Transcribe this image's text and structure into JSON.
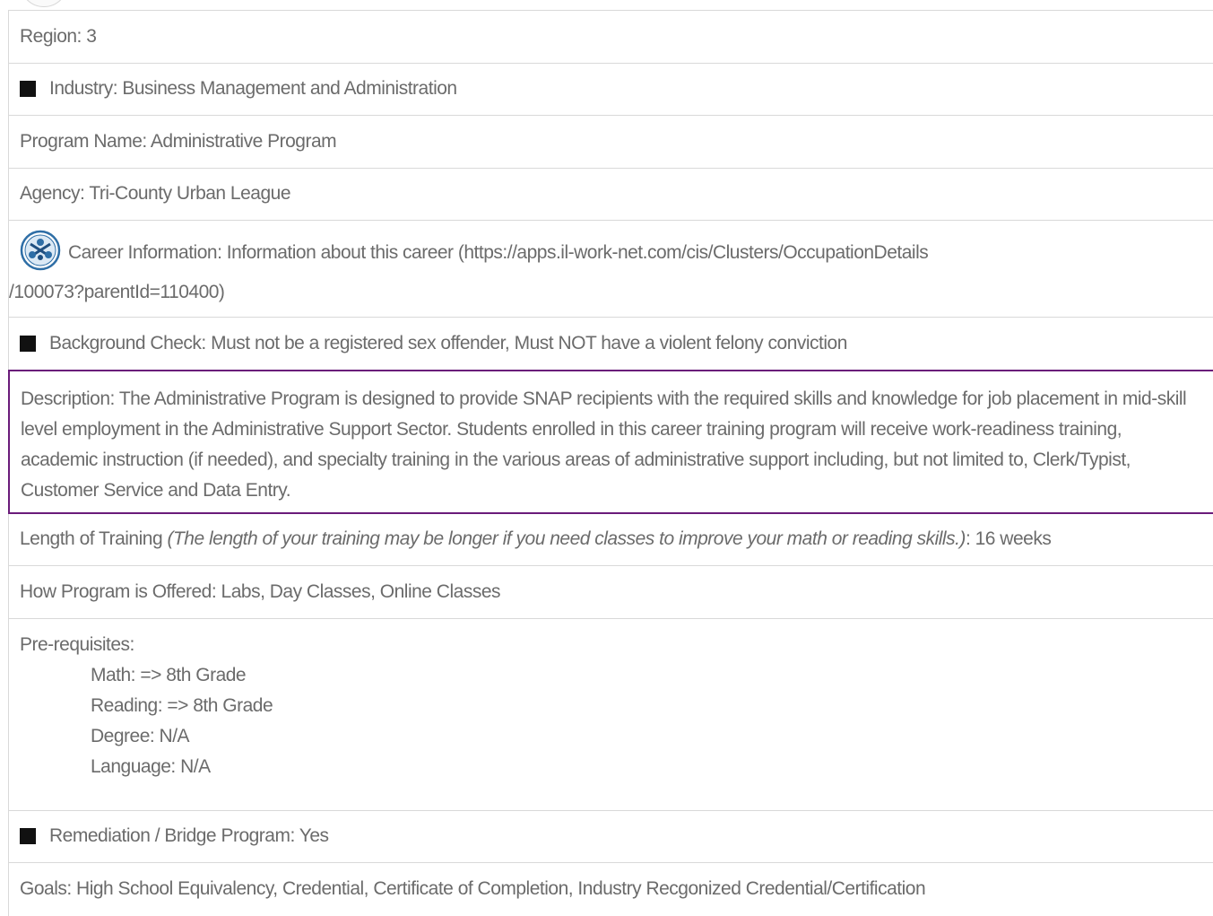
{
  "rows": {
    "region": "Region: 3",
    "industry": "Industry: Business Management and Administration",
    "program_name": "Program Name: Administrative Program",
    "agency": "Agency: Tri-County Urban League",
    "career_line1": "Career Information: Information about this career (https://apps.il-work-net.com/cis/Clusters/OccupationDetails",
    "career_line2": "/100073?parentId=110400)",
    "background": "Background Check: Must not be a registered sex offender, Must NOT have a violent felony conviction",
    "description": "Description: The Administrative Program is designed to provide SNAP recipients with the required skills and knowledge for job placement in mid-skill level employment in the Administrative Support Sector. Students enrolled in this career training program will receive work-readiness training, academic instruction (if needed), and specialty training in the various areas of administrative support including, but not limited to, Clerk/Typist, Customer Service and Data Entry.",
    "length_label": "Length of Training ",
    "length_note": "(The length of your training may be longer if you need classes to improve your math or reading skills.)",
    "length_value": ": 16 weeks",
    "offered": "How Program is Offered: Labs, Day Classes, Online Classes",
    "prereq_title": "Pre-requisites:",
    "prereq_math": "Math: => 8th Grade",
    "prereq_reading": "Reading: => 8th Grade",
    "prereq_degree": "Degree: N/A",
    "prereq_language": "Language: N/A",
    "remediation": "Remediation / Bridge Program: Yes",
    "goals": "Goals: High School Equivalency, Credential, Certificate of Completion, Industry Recgonized Credential/Certification"
  },
  "icons": {
    "bullet": "black-square-icon",
    "career": "career-cluster-logo-icon"
  },
  "colors": {
    "text": "#6b6b6b",
    "border": "#d9d9d9",
    "highlight_border": "#6a1b7a"
  }
}
